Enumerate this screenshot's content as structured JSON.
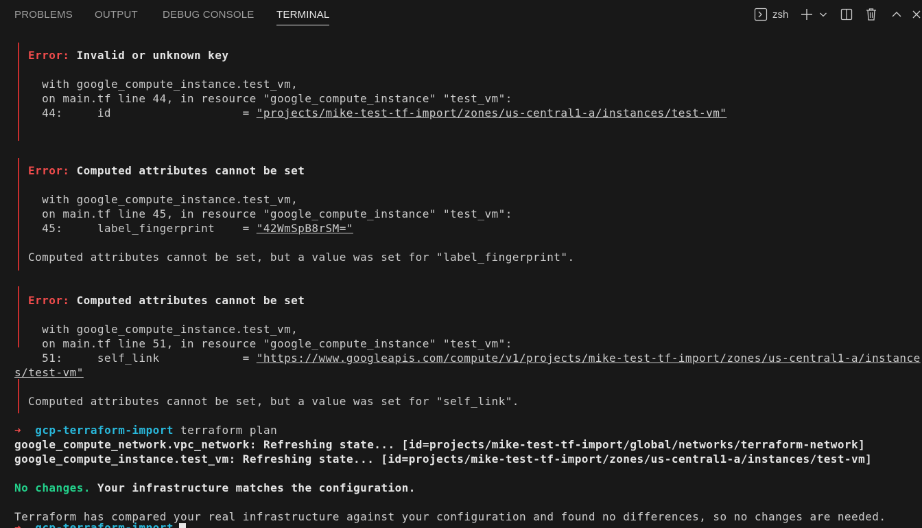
{
  "panel": {
    "tabs": [
      {
        "label": "PROBLEMS"
      },
      {
        "label": "OUTPUT"
      },
      {
        "label": "DEBUG CONSOLE"
      },
      {
        "label": "TERMINAL"
      }
    ],
    "active_tab": "TERMINAL",
    "shell": "zsh",
    "toolbar_icons": [
      "terminal-icon",
      "plus-icon",
      "chevron-down-icon",
      "split-icon",
      "trash-icon",
      "chevron-up-icon",
      "close-icon"
    ]
  },
  "colors": {
    "background": "#181818",
    "error_red": "#f14c4c",
    "error_bar": "#c72e2e",
    "success_green": "#23d18b",
    "prompt_cyan": "#29b8db",
    "text": "#cccccc"
  },
  "terminal": {
    "error1": {
      "label": "Error:",
      "title": "Invalid or unknown key",
      "with": "  with google_compute_instance.test_vm,",
      "on": "  on main.tf line 44, in resource \"google_compute_instance\" \"test_vm\":",
      "code_prefix": "  44:     id                   = ",
      "code_value": "\"projects/mike-test-tf-import/zones/us-central1-a/instances/test-vm\""
    },
    "error2": {
      "label": "Error:",
      "title": "Computed attributes cannot be set",
      "with": "  with google_compute_instance.test_vm,",
      "on": "  on main.tf line 45, in resource \"google_compute_instance\" \"test_vm\":",
      "code_prefix": "  45:     label_fingerprint    = ",
      "code_value": "\"42WmSpB8rSM=\"",
      "message": "Computed attributes cannot be set, but a value was set for \"label_fingerprint\"."
    },
    "error3": {
      "label": "Error:",
      "title": "Computed attributes cannot be set",
      "with": "  with google_compute_instance.test_vm,",
      "on": "  on main.tf line 51, in resource \"google_compute_instance\" \"test_vm\":",
      "code_prefix": "  51:     self_link            = ",
      "code_value": "\"https://www.googleapis.com/compute/v1/projects/mike-test-tf-import/zones/us-central1-a/instance",
      "code_value_wrap": "s/test-vm\"",
      "message": "Computed attributes cannot be set, but a value was set for \"self_link\"."
    },
    "prompt": {
      "arrow": "➜",
      "dir": "gcp-terraform-import",
      "command": "terraform plan"
    },
    "refresh1": "google_compute_network.vpc_network: Refreshing state... [id=projects/mike-test-tf-import/global/networks/terraform-network]",
    "refresh2": "google_compute_instance.test_vm: Refreshing state... [id=projects/mike-test-tf-import/zones/us-central1-a/instances/test-vm]",
    "no_changes": "No changes.",
    "matches": "Your infrastructure matches the configuration.",
    "summary": "Terraform has compared your real infrastructure against your configuration and found no differences, so no changes are needed.",
    "prompt2": {
      "arrow": "➜",
      "dir": "gcp-terraform-import"
    }
  }
}
